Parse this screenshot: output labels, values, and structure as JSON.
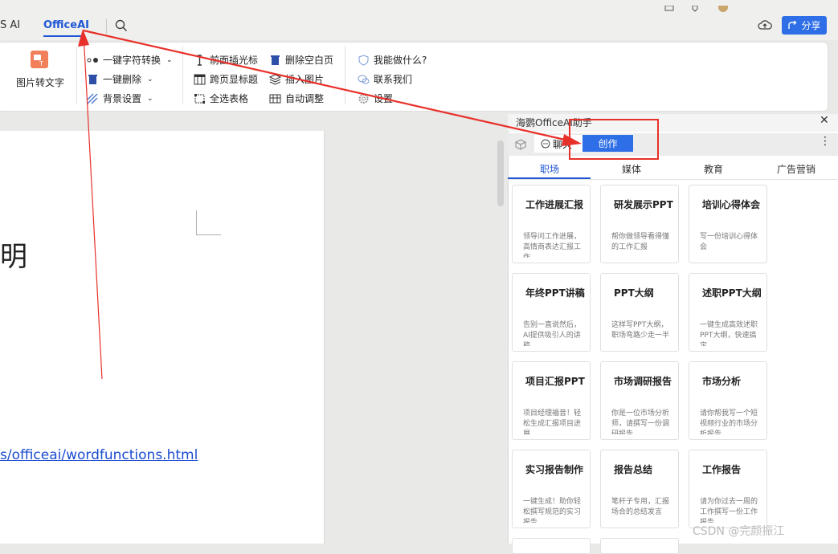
{
  "tabs": {
    "wps_ai": "S AI",
    "officeai": "OfficeAI"
  },
  "topbar": {
    "share_label": "分享"
  },
  "ribbon": {
    "image_to_text": "图片转文字",
    "col1": [
      {
        "label": "一键字符转换",
        "icon": "char-convert-icon"
      },
      {
        "label": "一键删除",
        "icon": "delete-icon"
      },
      {
        "label": "背景设置",
        "icon": "background-icon"
      }
    ],
    "col2": [
      {
        "label": "前面插光标",
        "icon": "cursor-icon"
      },
      {
        "label": "跨页显标题",
        "icon": "table-header-icon"
      },
      {
        "label": "全选表格",
        "icon": "select-table-icon"
      }
    ],
    "col3": [
      {
        "label": "删除空白页",
        "icon": "delete-page-icon"
      },
      {
        "label": "插入图片",
        "icon": "insert-image-icon"
      },
      {
        "label": "自动调整",
        "icon": "auto-adjust-icon"
      }
    ],
    "col4": [
      {
        "label": "我能做什么?",
        "icon": "help-icon"
      },
      {
        "label": "联系我们",
        "icon": "contact-icon"
      },
      {
        "label": "设置",
        "icon": "settings-icon"
      }
    ]
  },
  "document": {
    "char": "明",
    "link": "s/officeai/wordfunctions.html"
  },
  "panel": {
    "title": "海鹦OfficeAI助手",
    "chat_tab": "聊天",
    "create_tab": "创作",
    "categories": [
      "职场",
      "媒体",
      "教育",
      "广告营销"
    ],
    "cards": [
      {
        "title": "工作进展汇报",
        "desc": "领导问工作进展，高情商表达汇报工作"
      },
      {
        "title": "研发展示PPT",
        "desc": "帮你做领导看得懂的工作汇报"
      },
      {
        "title": "培训心得体会",
        "desc": "写一份培训心得体会"
      },
      {
        "title": "年终PPT讲稿",
        "desc": "告别一直说然后，AI提供吸引人的讲稿"
      },
      {
        "title": "PPT大纲",
        "desc": "这样写PPT大纲，职场弯路少走一半"
      },
      {
        "title": "述职PPT大纲",
        "desc": "一键生成高效述职PPT大纲，快速搞定"
      },
      {
        "title": "项目汇报PPT",
        "desc": "项目经理福音！轻松生成汇报项目进展"
      },
      {
        "title": "市场调研报告",
        "desc": "你是一位市场分析师，请撰写一份调研报告"
      },
      {
        "title": "市场分析",
        "desc": "请你帮我写一个短视频行业的市场分析报告"
      },
      {
        "title": "实习报告制作",
        "desc": "一键生成！助你轻松撰写规范的实习报告"
      },
      {
        "title": "报告总结",
        "desc": "笔杆子专用，汇报场合的总结发言"
      },
      {
        "title": "工作报告",
        "desc": "请为你过去一周的工作撰写一份工作报告"
      }
    ]
  },
  "watermark": "CSDN @完颜振江",
  "colors": {
    "accent": "#2e6ee6",
    "annotation": "#e8302a"
  }
}
